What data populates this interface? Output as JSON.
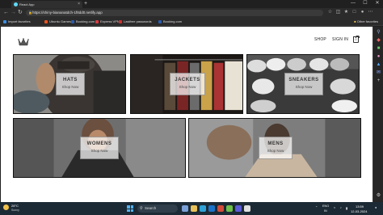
{
  "browser": {
    "tab_title": "React App",
    "new_tab_symbol": "+",
    "tab_close_symbol": "×",
    "url": "https://shiny-biananatdch-1f8dd0.netlify.app",
    "nav_icons": [
      "back-icon",
      "forward-icon",
      "refresh-icon"
    ],
    "window_controls": [
      "—",
      "☐",
      "✕"
    ]
  },
  "bookmarks": {
    "items": [
      {
        "label": "Import favorites",
        "color": "#3a8ee6"
      },
      {
        "label": "Ubuntu Games",
        "color": "#e95420"
      },
      {
        "label": "Booking.com",
        "color": "#2a5cb0"
      },
      {
        "label": "Express VPN",
        "color": "#da3940"
      },
      {
        "label": "Lastfree passwords",
        "color": "#d22d2d"
      },
      {
        "label": "Booking.com",
        "color": "#2a5cb0"
      }
    ],
    "other_label": "Other favorites"
  },
  "site": {
    "nav": {
      "shop": "SHOP",
      "signin": "SIGN IN"
    },
    "cart_count": "0",
    "categories": [
      {
        "title": "HATS",
        "subtitle": "Shop Now"
      },
      {
        "title": "JACKETS",
        "subtitle": "Shop Now"
      },
      {
        "title": "SNEAKERS",
        "subtitle": "Shop Now"
      },
      {
        "title": "WOMENS",
        "subtitle": "Shop Now"
      },
      {
        "title": "MENS",
        "subtitle": "Shop Now"
      }
    ]
  },
  "taskbar": {
    "weather_temp": "28°C",
    "weather_cond": "Sunny",
    "search_label": "Search",
    "lang": "ENG",
    "lang_sub": "IN",
    "time": "13:59",
    "date": "12-03-2024"
  }
}
